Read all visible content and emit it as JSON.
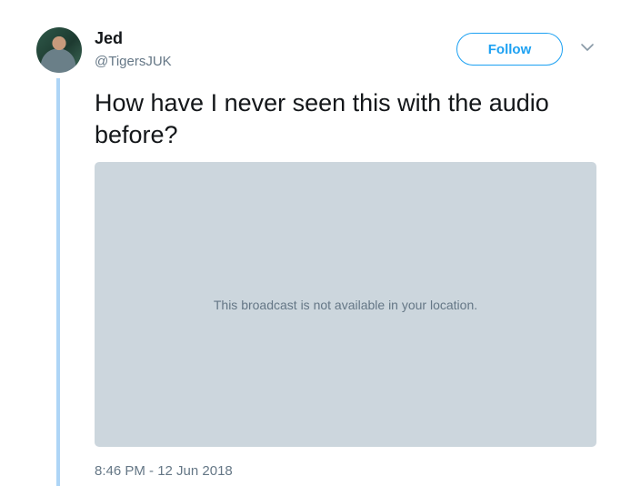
{
  "author": {
    "display_name": "Jed",
    "handle": "@TigersJUK"
  },
  "actions": {
    "follow_label": "Follow",
    "menu_icon": "chevron-down-icon"
  },
  "tweet": {
    "text": "How have I never seen this with the audio before?",
    "media_message": "This broadcast is not available in your location.",
    "timestamp": "8:46 PM - 12 Jun 2018"
  },
  "colors": {
    "accent": "#1da1f2",
    "thread_line": "#aed5f6",
    "media_background": "#ccd6dd",
    "secondary_text": "#657786"
  }
}
